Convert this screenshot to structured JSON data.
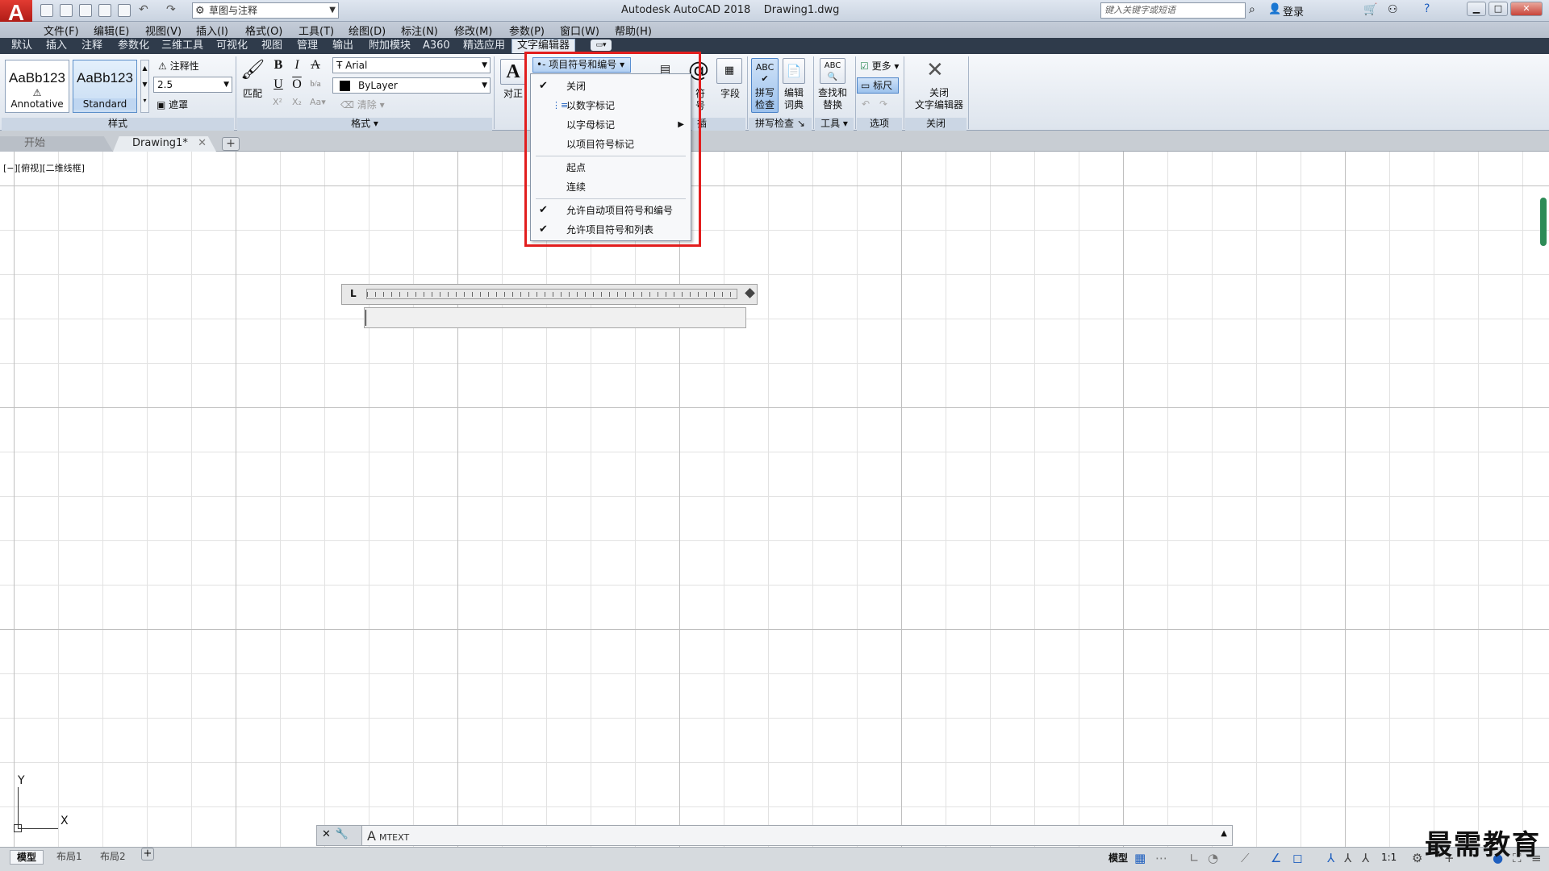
{
  "titlebar": {
    "app_title": "Autodesk AutoCAD 2018",
    "document_name": "Drawing1.dwg",
    "workspace": "草图与注释",
    "search_placeholder": "键入关键字或短语",
    "login": "登录"
  },
  "menubar": [
    "文件(F)",
    "编辑(E)",
    "视图(V)",
    "插入(I)",
    "格式(O)",
    "工具(T)",
    "绘图(D)",
    "标注(N)",
    "修改(M)",
    "参数(P)",
    "窗口(W)",
    "帮助(H)"
  ],
  "ribbon_tabs": [
    {
      "label": "默认"
    },
    {
      "label": "插入"
    },
    {
      "label": "注释"
    },
    {
      "label": "参数化"
    },
    {
      "label": "三维工具"
    },
    {
      "label": "可视化"
    },
    {
      "label": "视图"
    },
    {
      "label": "管理"
    },
    {
      "label": "输出"
    },
    {
      "label": "附加模块"
    },
    {
      "label": "A360"
    },
    {
      "label": "精选应用"
    },
    {
      "label": "文字编辑器",
      "active": true
    }
  ],
  "ribbon": {
    "style_panel": {
      "title": "样式",
      "style1_sample": "AaBb123",
      "style1_name": "Annotative",
      "style2_sample": "AaBb123",
      "style2_name": "Standard",
      "annotative_label": "注释性",
      "text_height": "2.5",
      "mask_label": "遮罩"
    },
    "format_panel": {
      "title": "格式",
      "match_label": "匹配",
      "font": "Arial",
      "color": "ByLayer",
      "clear_label": "清除"
    },
    "paragraph_panel": {
      "justify_label": "对正"
    },
    "insert_panel": {
      "symbol_label": "符号",
      "field_label": "字段",
      "title": "插入"
    },
    "spell_panel": {
      "title": "拼写检查",
      "spell_check_label": "拼写\n检查",
      "edit_dictionary_label": "编辑\n词典"
    },
    "tools_panel": {
      "title": "工具",
      "find_replace_label": "查找和\n替换"
    },
    "options_panel": {
      "title": "选项",
      "more_label": "更多",
      "ruler_label": "标尺"
    },
    "close_panel": {
      "title": "关闭",
      "close_editor_label": "关闭\n文字编辑器"
    }
  },
  "bullets_dropdown": {
    "button_label": "项目符号和编号",
    "items": [
      {
        "label": "关闭",
        "checked": true
      },
      {
        "label": "以数字标记",
        "checked": false
      },
      {
        "label": "以字母标记",
        "checked": false,
        "submenu": true
      },
      {
        "label": "以项目符号标记",
        "checked": false
      },
      {
        "label": "起点",
        "checked": false
      },
      {
        "label": "连续",
        "checked": false
      },
      {
        "label": "允许自动项目符号和编号",
        "checked": true
      },
      {
        "label": "允许项目符号和列表",
        "checked": true
      }
    ]
  },
  "file_tabs": [
    {
      "label": "开始"
    },
    {
      "label": "Drawing1*",
      "active": true
    }
  ],
  "viewport_label": "[−][俯视][二维线框]",
  "ucs": {
    "x": "X",
    "y": "Y"
  },
  "command_line": {
    "prompt": "MTEXT",
    "icon": "A"
  },
  "layout_tabs": [
    {
      "label": "模型",
      "active": true
    },
    {
      "label": "布局1"
    },
    {
      "label": "布局2"
    }
  ],
  "statusbar": {
    "model_label": "模型",
    "scale": "1:1"
  },
  "watermark": "最需教育",
  "colors": {
    "highlight": "#e21e1e",
    "ribbon_tab_bg": "#2f3b4b",
    "accent": "#1f5fbf"
  }
}
